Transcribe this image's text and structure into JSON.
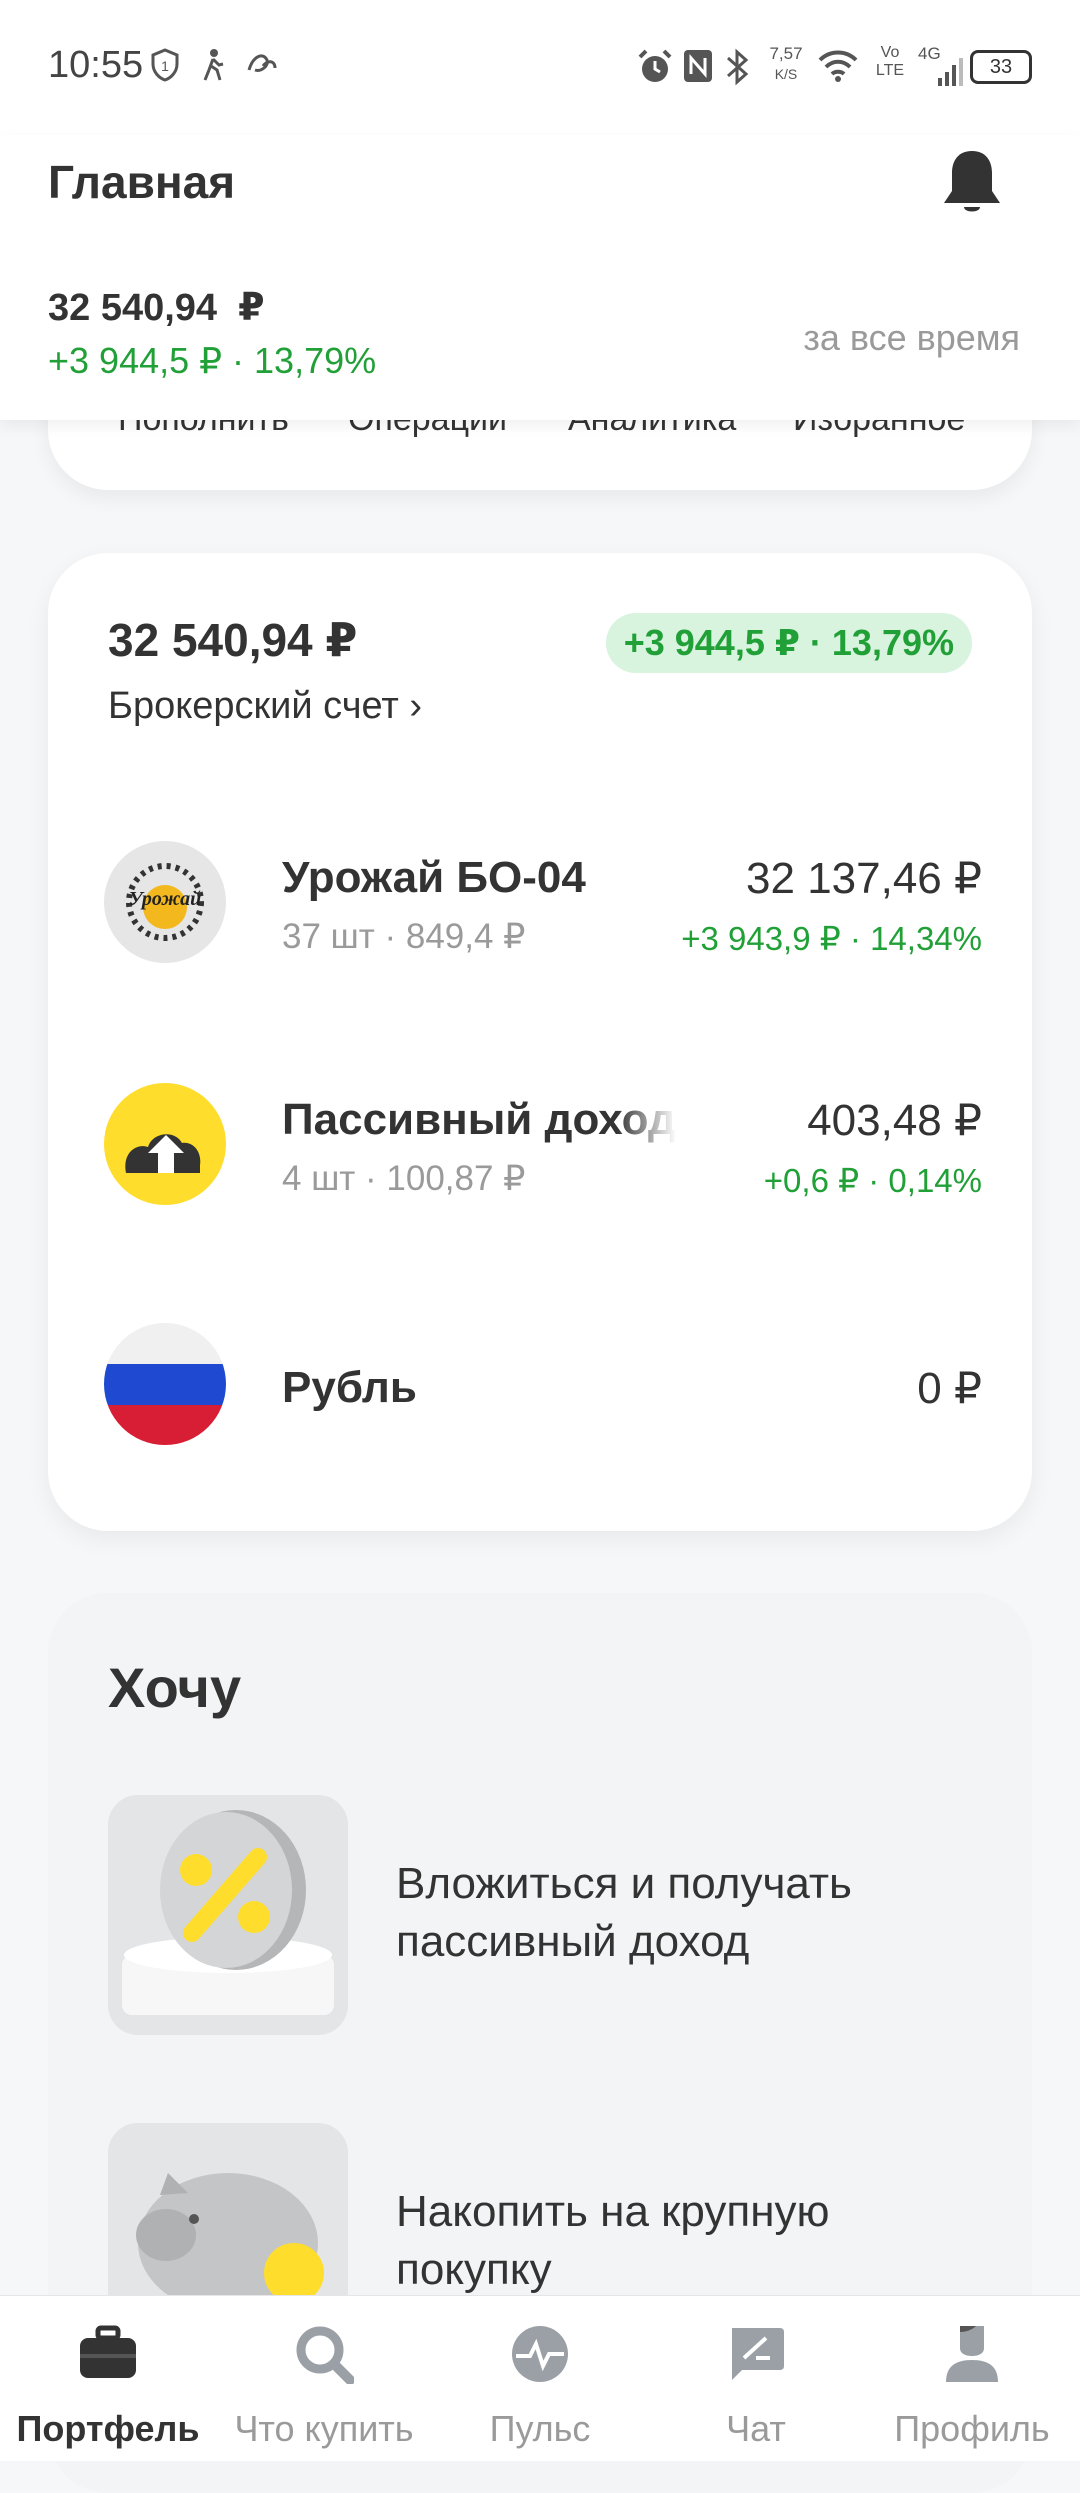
{
  "status_bar": {
    "time": "10:55",
    "net_speed": "7,57",
    "net_unit": "K/S",
    "volte": "Vo LTE",
    "signal": "4G",
    "battery": "33"
  },
  "header": {
    "title": "Главная",
    "total": "32 540,94  ₽",
    "delta": "+3 944,5 ₽ · 13,79%",
    "period": "за все время"
  },
  "quick_actions": [
    "Пополнить",
    "Операции",
    "Аналитика",
    "Избранное"
  ],
  "account": {
    "total": "32 540,94 ₽",
    "badge": "+3 944,5 ₽ · 13,79%",
    "name": "Брокерский счет ›",
    "items": [
      {
        "name": "Урожай БО-04",
        "sub": "37 шт · 849,4 ₽",
        "value": "32 137,46 ₽",
        "change": "+3 943,9 ₽ · 14,34%",
        "logo_text": "Урожай"
      },
      {
        "name": "Пассивный доход",
        "sub": "4 шт · 100,87 ₽",
        "value": "403,48 ₽",
        "change": "+0,6 ₽ · 0,14%"
      },
      {
        "name": "Рубль",
        "value": "0 ₽"
      }
    ]
  },
  "wants": {
    "title": "Хочу",
    "items": [
      {
        "text": "Вложиться и получать пассивный доход"
      },
      {
        "text": "Накопить на крупную покупку"
      }
    ]
  },
  "tabs": [
    {
      "label": "Портфель",
      "icon": "briefcase-icon",
      "active": true
    },
    {
      "label": "Что купить",
      "icon": "search-icon"
    },
    {
      "label": "Пульс",
      "icon": "pulse-icon"
    },
    {
      "label": "Чат",
      "icon": "chat-icon"
    },
    {
      "label": "Профиль",
      "icon": "profile-icon"
    }
  ],
  "colors": {
    "accent_green": "#21a038",
    "badge_bg": "#d8f3de",
    "flag_white": "#ffffff",
    "flag_blue": "#1f49d1",
    "flag_red": "#d81e34",
    "yellow": "#ffdd2d"
  }
}
